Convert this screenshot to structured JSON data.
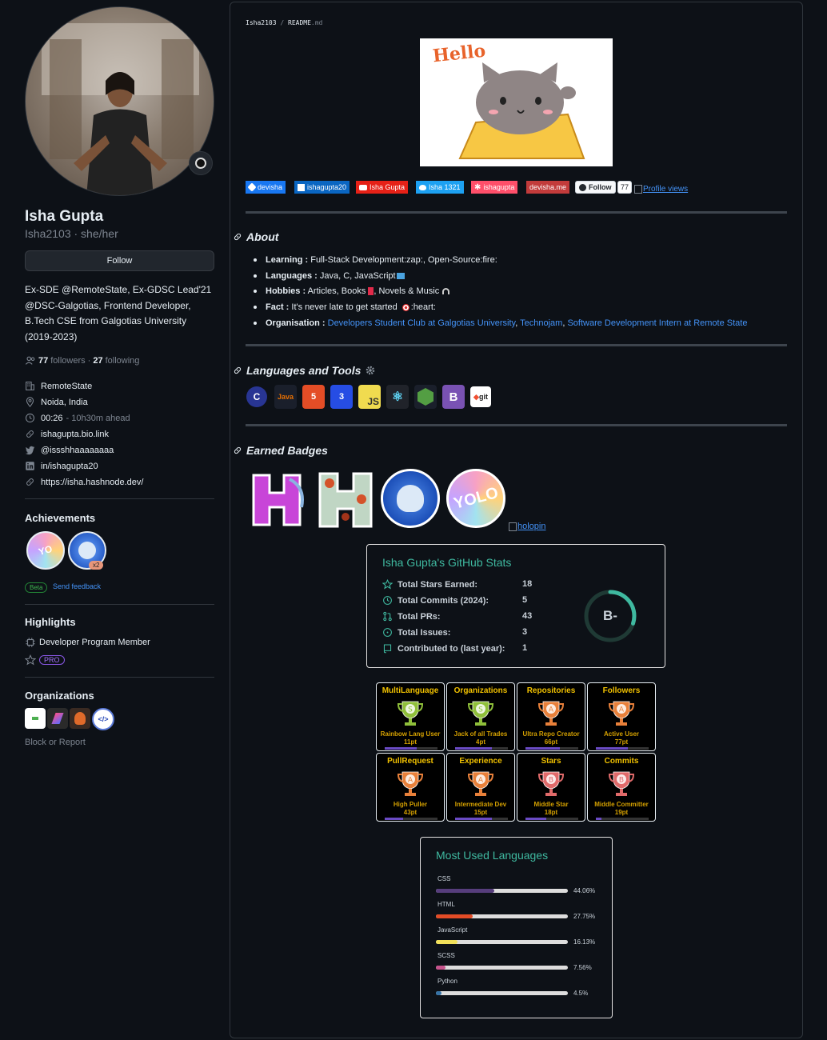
{
  "profile": {
    "name": "Isha Gupta",
    "handle_pronouns": "Isha2103 · she/her",
    "follow_label": "Follow",
    "bio_lines": [
      "Ex-SDE @RemoteState, Ex-GDSC Lead'21",
      "@DSC-Galgotias, Frontend Developer,",
      "B.Tech CSE from Galgotias University",
      "(2019-2023)"
    ],
    "followers_count": "77",
    "followers_label": "followers",
    "sep": "·",
    "following_count": "27",
    "following_label": "following",
    "company": "RemoteState",
    "location": "Noida, India",
    "time": "00:26",
    "time_ahead": "- 10h30m ahead",
    "link1": "ishagupta.bio.link",
    "twitter": "@issshhaaaaaaaa",
    "linkedin": "in/ishagupta20",
    "link2": "https://isha.hashnode.dev/"
  },
  "achievements": {
    "title": "Achievements",
    "multiplier": "x2",
    "beta": "Beta",
    "feedback": "Send feedback"
  },
  "highlights": {
    "title": "Highlights",
    "item": "Developer Program Member",
    "pro": "PRO"
  },
  "organizations": {
    "title": "Organizations",
    "block": "Block or Report"
  },
  "readme": {
    "path_user": "Isha2103",
    "path_sep": "/",
    "path_file": "README",
    "path_ext": ".md",
    "hello": "Hello",
    "badges": [
      {
        "label": "devisha",
        "color": "#1877f2"
      },
      {
        "label": "ishagupta20",
        "color": "#0a66c2"
      },
      {
        "label": "Isha Gupta",
        "color": "#e62117"
      },
      {
        "label": "Isha 1321",
        "color": "#1da1f2"
      },
      {
        "label": "ishagupta",
        "color": "#ff4f6a"
      },
      {
        "label": "devisha.me",
        "color": "#c23b3b"
      }
    ],
    "follow_btn": "Follow",
    "follow_count": "77",
    "profile_views": "Profile views"
  },
  "about": {
    "title": "About",
    "items": [
      {
        "label": "Learning :",
        "text": " Full-Stack Development:zap:, Open-Source:fire:"
      },
      {
        "label": "Languages :",
        "text": " Java, C, JavaScript"
      },
      {
        "label": "Hobbies :",
        "text": " Articles, Books",
        "text2": ", Novels & Music"
      },
      {
        "label": "Fact :",
        "text": " It's never late to get started",
        "text2": ":heart:"
      },
      {
        "label": "Organisation :",
        "link1": "Developers Student Club at Galgotias University",
        "link2": "Technojam",
        "link3": "Software Development Intern at Remote State"
      }
    ],
    "comma": ","
  },
  "tools": {
    "title": "Languages and Tools",
    "items": [
      "C",
      "Java",
      "HTML5",
      "CSS3",
      "JS",
      "React",
      "Node",
      "Bootstrap",
      "git"
    ]
  },
  "badges_section": {
    "title": "Earned Badges",
    "holopin": "holopin"
  },
  "stats": {
    "title": "Isha Gupta's GitHub Stats",
    "rows": [
      {
        "label": "Total Stars Earned:",
        "value": "18"
      },
      {
        "label": "Total Commits (2024):",
        "value": "5"
      },
      {
        "label": "Total PRs:",
        "value": "43"
      },
      {
        "label": "Total Issues:",
        "value": "3"
      },
      {
        "label": "Contributed to (last year):",
        "value": "1"
      }
    ],
    "grade": "B-",
    "grade_progress": 0.3,
    "accent": "#3fb9a0"
  },
  "trophies": [
    {
      "title": "MultiLanguage",
      "rank": "S",
      "name": "Rainbow Lang User",
      "pt": "11pt",
      "progress": 0.6
    },
    {
      "title": "Organizations",
      "rank": "S",
      "name": "Jack of all Trades",
      "pt": "4pt",
      "progress": 0.7
    },
    {
      "title": "Repositories",
      "rank": "A",
      "name": "Ultra Repo Creator",
      "pt": "66pt",
      "progress": 0.65
    },
    {
      "title": "Followers",
      "rank": "A",
      "name": "Active User",
      "pt": "77pt",
      "progress": 0.6
    },
    {
      "title": "PullRequest",
      "rank": "A",
      "name": "High Puller",
      "pt": "43pt",
      "progress": 0.35
    },
    {
      "title": "Experience",
      "rank": "A",
      "name": "Intermediate Dev",
      "pt": "15pt",
      "progress": 0.7
    },
    {
      "title": "Stars",
      "rank": "B",
      "name": "Middle Star",
      "pt": "18pt",
      "progress": 0.4
    },
    {
      "title": "Commits",
      "rank": "B",
      "name": "Middle Committer",
      "pt": "19pt",
      "progress": 0.1
    }
  ],
  "languages": {
    "title": "Most Used Languages",
    "items": [
      {
        "name": "CSS",
        "pct": "44.06%",
        "value": 44.06,
        "color": "#563d7c"
      },
      {
        "name": "HTML",
        "pct": "27.75%",
        "value": 27.75,
        "color": "#e34c26"
      },
      {
        "name": "JavaScript",
        "pct": "16.13%",
        "value": 16.13,
        "color": "#f1e05a"
      },
      {
        "name": "SCSS",
        "pct": "7.56%",
        "value": 7.56,
        "color": "#c6538c"
      },
      {
        "name": "Python",
        "pct": "4.5%",
        "value": 4.5,
        "color": "#3572A5"
      }
    ]
  }
}
